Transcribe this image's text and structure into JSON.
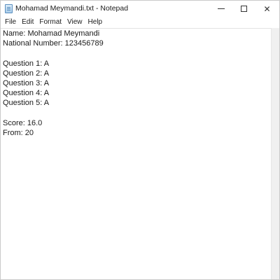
{
  "window": {
    "title": "Mohamad Meymandi.txt - Notepad",
    "app_icon": "notepad-icon",
    "caption_buttons": {
      "minimize_icon": "minimize-icon",
      "maximize_icon": "maximize-icon",
      "close_icon": "close-icon",
      "close_glyph": "✕"
    }
  },
  "menu": {
    "items": [
      "File",
      "Edit",
      "Format",
      "View",
      "Help"
    ]
  },
  "editor": {
    "lines": [
      "Name: Mohamad Meymandi",
      "National Number: 123456789",
      "",
      "Question 1: A",
      "Question 2: A",
      "Question 3: A",
      "Question 4: A",
      "Question 5: A",
      "",
      "Score: 16.0",
      "From: 20"
    ]
  }
}
